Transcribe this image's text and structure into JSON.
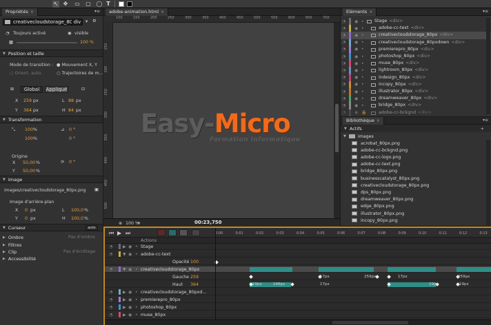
{
  "toolbar": {
    "icons": [
      "arrow-icon",
      "hand-icon",
      "rect-icon",
      "rounded-rect-icon",
      "ellipse-icon",
      "text-icon"
    ]
  },
  "props": {
    "tab": "Propriétés",
    "element_name": "creativecloudstorage_80px",
    "element_tag": "div",
    "always_active": "Toujours activé",
    "visible": "visible",
    "opacity": "100 %",
    "sec_position": "Position et taille",
    "transition_mode": "Mode de transition :",
    "move_xy": "Mouvement X, Y",
    "orient_auto": "Orient. auto.",
    "trajectories": "Trajectoires de m...",
    "global": "Global",
    "applied": "Appliqué",
    "x_label": "X",
    "x_val": "259",
    "x_unit": "px",
    "y_label": "Y",
    "y_val": "364",
    "y_unit": "px",
    "l_label": "L",
    "l_val": "88",
    "l_unit": "px",
    "h_label": "H",
    "h_val": "84",
    "h_unit": "px",
    "sec_transform": "Transformation",
    "scale_x": "100",
    "scale_y": "100",
    "pct": "%",
    "skew_x": "0",
    "skew_y": "0",
    "deg": "°",
    "rotate": "0",
    "origin": "Origine",
    "origin_x": "50,00",
    "origin_y": "50,00",
    "sec_image": "Image",
    "image_path": "images/creativecloudstorage_80px.png",
    "bg_image": "Image d'arrière-plan",
    "bg_x": "0",
    "bg_y": "0",
    "bg_l": "100,0",
    "bg_h": "100,0",
    "px": "px",
    "sec_cursor": "Curseur",
    "cursor_auto": "auto",
    "sec_shadow": "Ombre",
    "no_shadow": "Pas d'ombre",
    "sec_filters": "Filtres",
    "sec_clip": "Clip",
    "no_clip": "Pas d'écrêtage",
    "sec_access": "Accessibilité"
  },
  "stage": {
    "tab": "adobe-animation.html",
    "ruler_top": [
      "100",
      "150",
      "200",
      "250",
      "300",
      "350",
      "400",
      "450",
      "500",
      "550",
      "600",
      "650",
      "700"
    ],
    "ruler_left": [
      "150",
      "200",
      "250",
      "300",
      "350",
      "400",
      "450",
      "500"
    ],
    "zoom": "100 %",
    "time": "00:23,750",
    "logo_easy": "Easy-",
    "logo_micro": "Micro",
    "logo_sub": "Formation informatique"
  },
  "elements": {
    "tab": "Eléments",
    "rows": [
      {
        "name": "Stage",
        "tag": "<div>",
        "color": "#6e6e6e"
      },
      {
        "name": "adobe-cc-text",
        "tag": "<div>",
        "color": "#c7b340"
      },
      {
        "name": "creativecloudstorage_80px",
        "tag": "<div>",
        "color": "#8a6fc4"
      },
      {
        "name": "creativecloudstorage_80pxdown",
        "tag": "<div>",
        "color": "#6fb0c4"
      },
      {
        "name": "premierepro_80px",
        "tag": "<div>",
        "color": "#9a7fd6"
      },
      {
        "name": "photoshop_80px",
        "tag": "<div>",
        "color": "#3e8fd0"
      },
      {
        "name": "muse_80px",
        "tag": "<div>",
        "color": "#d04a6a"
      },
      {
        "name": "lightroom_80px",
        "tag": "<div>",
        "color": "#6a8ec4"
      },
      {
        "name": "indesign_80px",
        "tag": "<div>",
        "color": "#c43a7a"
      },
      {
        "name": "incopy_80px",
        "tag": "<div>",
        "color": "#c48f3a"
      },
      {
        "name": "illustrator_80px",
        "tag": "<div>",
        "color": "#c4762a"
      },
      {
        "name": "dreamweaver_80px",
        "tag": "<div>",
        "color": "#4aa86a"
      },
      {
        "name": "bridge_80px",
        "tag": "<div>",
        "color": "#8a8a8a"
      },
      {
        "name": "adobe-cc-bckgnd",
        "tag": "<div>",
        "color": "#5a5a5a"
      }
    ]
  },
  "library": {
    "tab": "Bibliothèque",
    "assets": "Actifs",
    "folder": "images",
    "files": [
      "acrobat_80px.png",
      "adobe-cc-bckgnd.png",
      "adobe-cc-logo.png",
      "adobe-cc-text.png",
      "bridge_80px.png",
      "businesscatalyst_80px.png",
      "creativecloudstorage_80px.png",
      "dps_80px.png",
      "dreamweaver_80px.png",
      "edge_80px.png",
      "illustrator_80px.png",
      "incopy_80px.png"
    ]
  },
  "timeline": {
    "ticks": [
      "0:00",
      "0:01",
      "0:02",
      "0:03",
      "0:04",
      "0:05",
      "0:06",
      "0:07",
      "0:08",
      "0:09",
      "0:10",
      "0:11",
      "0:12",
      "0:13"
    ],
    "actions": "Actions",
    "rows": [
      {
        "name": "Stage",
        "color": "#6e6e6e"
      },
      {
        "name": "adobe-cc-text",
        "color": "#c7b340"
      },
      {
        "name": "Opacité",
        "value": "100",
        "sub": true
      },
      {
        "name": "creativecloudstorage_80px",
        "color": "#8a6fc4",
        "selected": true
      },
      {
        "name": "Gauche",
        "value": "259",
        "sub": true
      },
      {
        "name": "Haut",
        "value": "364",
        "sub": true
      },
      {
        "name": "creativecloudstorage_80pxd...",
        "color": "#6fb0c4"
      },
      {
        "name": "premierepro_80px",
        "color": "#9a7fd6"
      },
      {
        "name": "photoshop_80px",
        "color": "#3e8fd0"
      },
      {
        "name": "muse_80px",
        "color": "#d04a6a"
      }
    ],
    "kf_gauche": [
      "259px",
      "17px",
      "259px",
      "17px",
      "259px"
    ],
    "kf_haut": [
      "19px",
      "248px",
      "17px",
      "19px",
      "19px"
    ]
  }
}
